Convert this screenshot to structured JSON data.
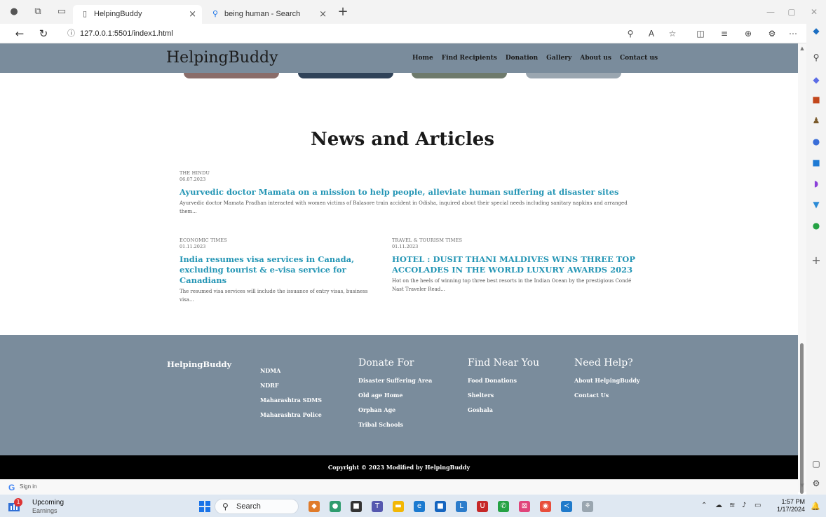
{
  "browser": {
    "tabs": [
      {
        "title": "HelpingBuddy",
        "favicon": "page-icon"
      },
      {
        "title": "being human - Search",
        "favicon": "search-icon"
      }
    ],
    "address": "127.0.0.1:5501/index1.html"
  },
  "site": {
    "logo": "HelpingBuddy",
    "nav": [
      "Home",
      "Find Recipients",
      "Donation",
      "Gallery",
      "About us",
      "Contact us"
    ],
    "colors": {
      "header_bg": "#7a8c9c",
      "headline": "#2596b5",
      "copyright_bg": "#000000"
    }
  },
  "news": {
    "title": "News and Articles",
    "articles": [
      {
        "source": "THE HINDU",
        "date": "06.07.2023",
        "headline": "Ayurvedic doctor Mamata on a mission to help people, alleviate human suffering at disaster sites",
        "summary": "Ayurvedic doctor Mamata Pradhan interacted with women victims of Balasore train accident in Odisha, inquired about their special needs including sanitary napkins and arranged them..."
      },
      {
        "source": "ECONOMIC TIMES",
        "date": "01.11.2023",
        "headline": "India resumes visa services in Canada, excluding tourist & e-visa service for Canadians",
        "summary": "The resumed visa services will include the issuance of entry visas, business visa..."
      },
      {
        "source": "TRAVEL & TOURISM TIMES",
        "date": "01.11.2023",
        "headline": "HOTEL : DUSIT THANI MALDIVES WINS THREE TOP ACCOLADES IN THE WORLD LUXURY AWARDS 2023",
        "summary": "Hot on the heels of winning top three best resorts in the Indian Ocean by the prestigious Condé Nast Traveler Read..."
      }
    ]
  },
  "footer": {
    "brand": "HelpingBuddy",
    "links": [
      "NDMA",
      "NDRF",
      "Maharashtra SDMS",
      "Maharashtra Police"
    ],
    "donate": {
      "title": "Donate For",
      "items": [
        "Disaster Suffering Area",
        "Old age Home",
        "Orphan Age",
        "Tribal Schools"
      ]
    },
    "find": {
      "title": "Find Near You",
      "items": [
        "Food Donations",
        "Shelters",
        "Goshala"
      ]
    },
    "help": {
      "title": "Need Help?",
      "items": [
        "About HelpingBuddy",
        "Contact Us"
      ]
    },
    "copyright": "Copyright © 2023 Modified by HelpingBuddy"
  },
  "signin": {
    "label": "Sign in"
  },
  "taskbar": {
    "widget_title": "Upcoming",
    "widget_sub": "Earnings",
    "widget_badge": "1",
    "search": "Search",
    "time": "1:57 PM",
    "date": "1/17/2024"
  }
}
